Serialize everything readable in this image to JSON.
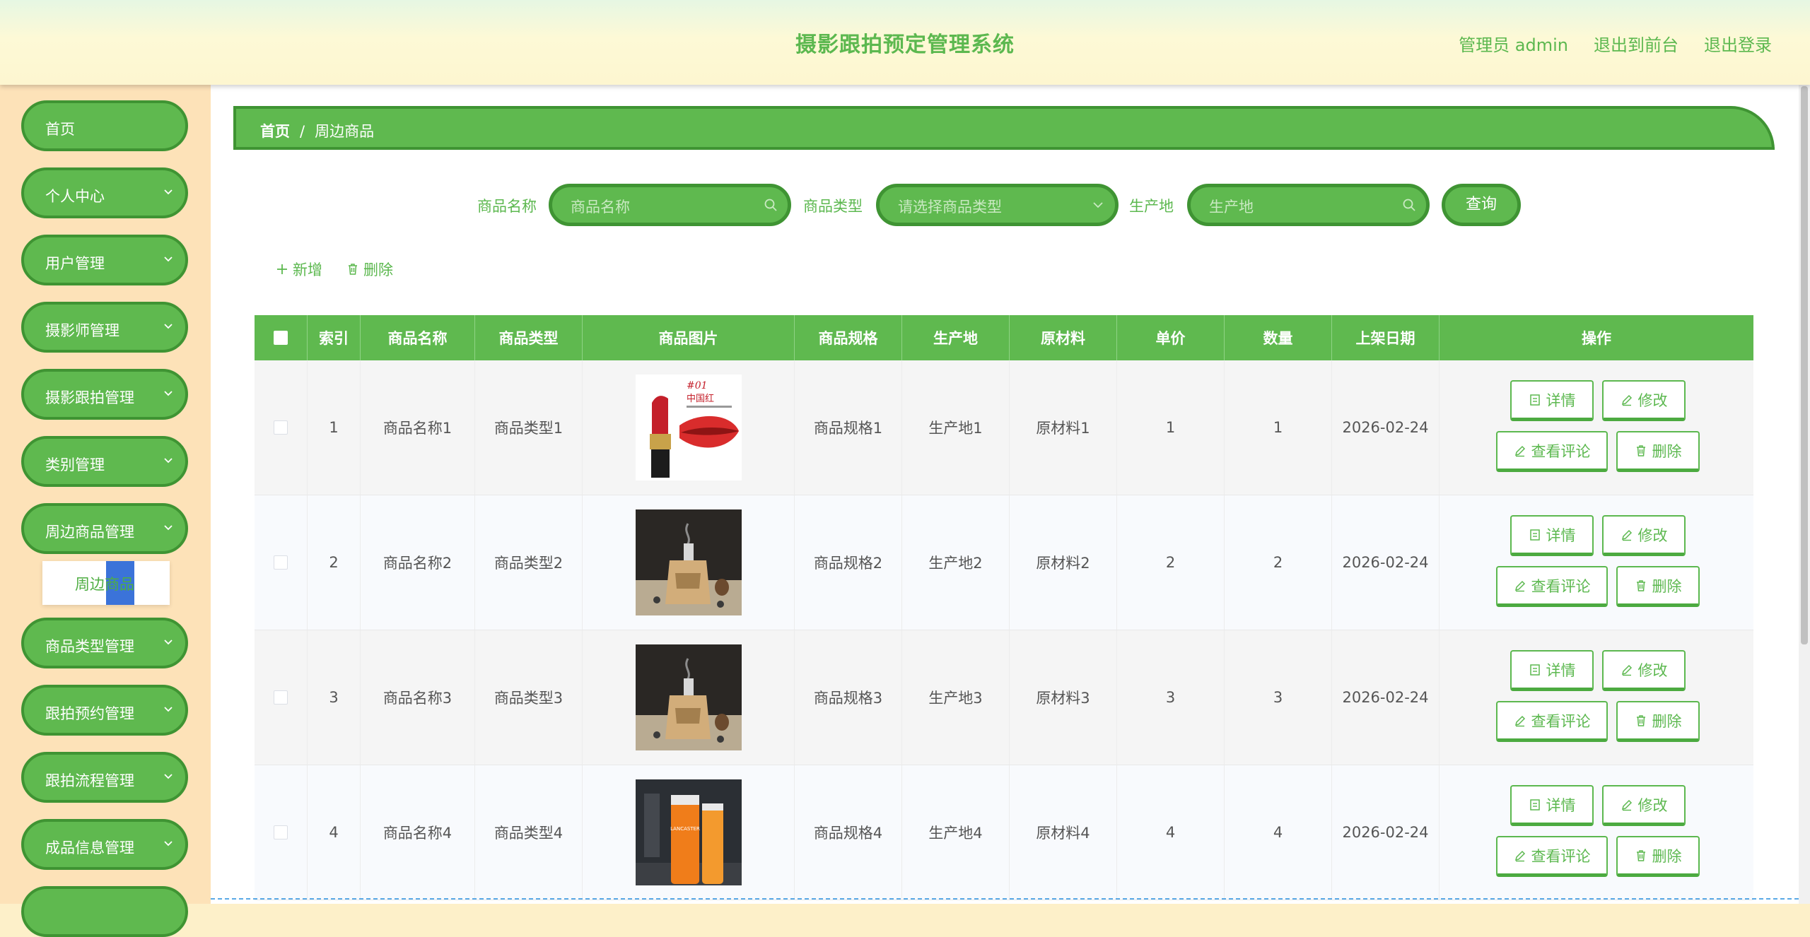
{
  "header": {
    "title": "摄影跟拍预定管理系统",
    "user": "管理员 admin",
    "to_front": "退出到前台",
    "logout": "退出登录"
  },
  "sidebar": {
    "items": [
      {
        "label": "首页",
        "has_chevron": false
      },
      {
        "label": "个人中心",
        "has_chevron": true
      },
      {
        "label": "用户管理",
        "has_chevron": true
      },
      {
        "label": "摄影师管理",
        "has_chevron": true
      },
      {
        "label": "摄影跟拍管理",
        "has_chevron": true
      },
      {
        "label": "类别管理",
        "has_chevron": true
      },
      {
        "label": "周边商品管理",
        "has_chevron": true
      },
      {
        "label": "商品类型管理",
        "has_chevron": true
      },
      {
        "label": "跟拍预约管理",
        "has_chevron": true
      },
      {
        "label": "跟拍流程管理",
        "has_chevron": true
      },
      {
        "label": "成品信息管理",
        "has_chevron": true
      }
    ],
    "submenu_label": "周边商品"
  },
  "breadcrumb": {
    "home": "首页",
    "separator": "/",
    "current": "周边商品"
  },
  "search": {
    "name_label": "商品名称",
    "name_placeholder": "商品名称",
    "type_label": "商品类型",
    "type_placeholder": "请选择商品类型",
    "origin_label": "生产地",
    "origin_placeholder": "生产地",
    "query_button": "查询"
  },
  "actions": {
    "add": "新增",
    "delete": "删除"
  },
  "table": {
    "columns": [
      "索引",
      "商品名称",
      "商品类型",
      "商品图片",
      "商品规格",
      "生产地",
      "原材料",
      "单价",
      "数量",
      "上架日期",
      "操作"
    ],
    "rows": [
      {
        "index": "1",
        "name": "商品名称1",
        "type": "商品类型1",
        "image": "lipstick",
        "spec": "商品规格1",
        "origin": "生产地1",
        "material": "原材料1",
        "price": "1",
        "qty": "1",
        "date": "2026-02-24"
      },
      {
        "index": "2",
        "name": "商品名称2",
        "type": "商品类型2",
        "image": "incense-burner",
        "spec": "商品规格2",
        "origin": "生产地2",
        "material": "原材料2",
        "price": "2",
        "qty": "2",
        "date": "2026-02-24"
      },
      {
        "index": "3",
        "name": "商品名称3",
        "type": "商品类型3",
        "image": "incense-burner",
        "spec": "商品规格3",
        "origin": "生产地3",
        "material": "原材料3",
        "price": "3",
        "qty": "3",
        "date": "2026-02-24"
      },
      {
        "index": "4",
        "name": "商品名称4",
        "type": "商品类型4",
        "image": "sunscreen-bottles",
        "spec": "商品规格4",
        "origin": "生产地4",
        "material": "原材料4",
        "price": "4",
        "qty": "4",
        "date": "2026-02-24"
      }
    ],
    "ops": {
      "detail": "详情",
      "edit": "修改",
      "comments": "查看评论",
      "delete": "删除"
    }
  },
  "image_text": {
    "lipstick_number": "#01",
    "lipstick_title": "中国红",
    "sunscreen_brand": "LANCASTER"
  },
  "colors": {
    "accent": "#5fb94f",
    "accent_dark": "#3f9433",
    "sidebar_bg": "#fde2b8",
    "highlight": "#3b73d9"
  }
}
